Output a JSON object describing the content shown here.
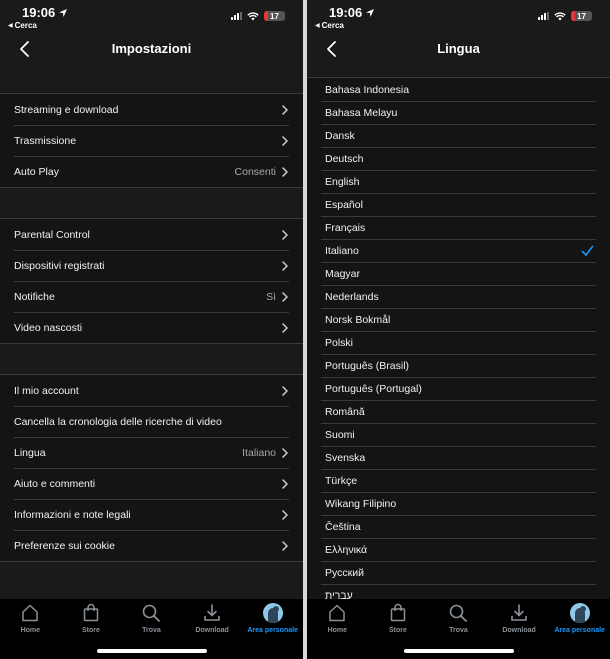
{
  "status_bar": {
    "time": "19:06",
    "back_app": "Cerca",
    "battery_level": "17"
  },
  "left_screen": {
    "title": "Impostazioni",
    "groups": [
      {
        "rows": [
          {
            "label": "Streaming e download",
            "value": "",
            "chevron": true
          },
          {
            "label": "Trasmissione",
            "value": "",
            "chevron": true
          },
          {
            "label": "Auto Play",
            "value": "Consenti",
            "chevron": true
          }
        ]
      },
      {
        "rows": [
          {
            "label": "Parental Control",
            "value": "",
            "chevron": true
          },
          {
            "label": "Dispositivi registrati",
            "value": "",
            "chevron": true
          },
          {
            "label": "Notifiche",
            "value": "Sì",
            "chevron": true
          },
          {
            "label": "Video nascosti",
            "value": "",
            "chevron": true
          }
        ]
      },
      {
        "rows": [
          {
            "label": "Il mio account",
            "value": "",
            "chevron": true
          },
          {
            "label": "Cancella la cronologia delle ricerche di video",
            "value": "",
            "chevron": false
          },
          {
            "label": "Lingua",
            "value": "Italiano",
            "chevron": true
          },
          {
            "label": "Aiuto e commenti",
            "value": "",
            "chevron": true
          },
          {
            "label": "Informazioni e note legali",
            "value": "",
            "chevron": true
          },
          {
            "label": "Preferenze sui cookie",
            "value": "",
            "chevron": true
          }
        ]
      }
    ]
  },
  "right_screen": {
    "title": "Lingua",
    "selected": "Italiano",
    "languages": [
      "Bahasa Indonesia",
      "Bahasa Melayu",
      "Dansk",
      "Deutsch",
      "English",
      "Español",
      "Français",
      "Italiano",
      "Magyar",
      "Nederlands",
      "Norsk Bokmål",
      "Polski",
      "Português (Brasil)",
      "Português (Portugal)",
      "Română",
      "Suomi",
      "Svenska",
      "Türkçe",
      "Wikang Filipino",
      "Čeština",
      "Ελληνικά",
      "Русский",
      "עברית"
    ]
  },
  "tab_bar": {
    "tabs": [
      {
        "label": "Home",
        "icon": "home-icon"
      },
      {
        "label": "Store",
        "icon": "shopping-bag-icon"
      },
      {
        "label": "Trova",
        "icon": "search-icon"
      },
      {
        "label": "Download",
        "icon": "download-icon"
      },
      {
        "label": "Area personale",
        "icon": "avatar-icon",
        "active": true
      }
    ]
  },
  "colors": {
    "background": "#1a1a1a",
    "accent": "#1a98ff",
    "battery_low": "#e5343a"
  }
}
